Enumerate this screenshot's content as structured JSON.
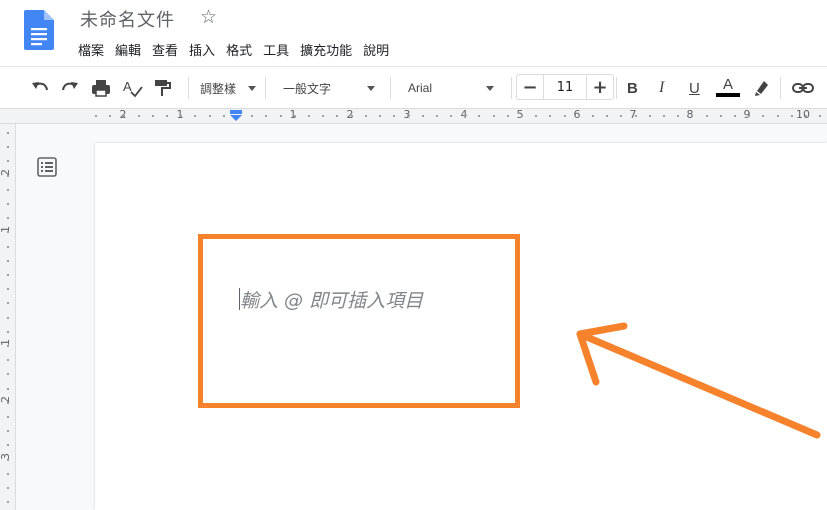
{
  "header": {
    "title": "未命名文件",
    "menu": [
      "檔案",
      "編輯",
      "查看",
      "插入",
      "格式",
      "工具",
      "擴充功能",
      "說明"
    ]
  },
  "toolbar": {
    "style_label": "調整樣",
    "paragraph_style": "一般文字",
    "font": "Arial",
    "font_size": "11",
    "minus": "−",
    "plus": "+",
    "bold": "B",
    "italic": "I",
    "underline": "U",
    "text_color": "A"
  },
  "ruler": {
    "labels": [
      "2",
      "1",
      "1",
      "2",
      "3",
      "4",
      "5",
      "6",
      "7",
      "8",
      "9",
      "10"
    ],
    "vertical_labels": [
      "2",
      "1",
      "1",
      "2",
      "3"
    ]
  },
  "editor": {
    "placeholder": "輸入 @ 即可插入項目"
  },
  "colors": {
    "annotation": "#f6822c",
    "doc_blue": "#4285f4",
    "ruler_marker": "#4285f4"
  },
  "icons": [
    "undo-icon",
    "redo-icon",
    "print-icon",
    "spellcheck-icon",
    "paint-format-icon",
    "highlight-icon",
    "link-icon",
    "outline-icon",
    "star-icon"
  ]
}
